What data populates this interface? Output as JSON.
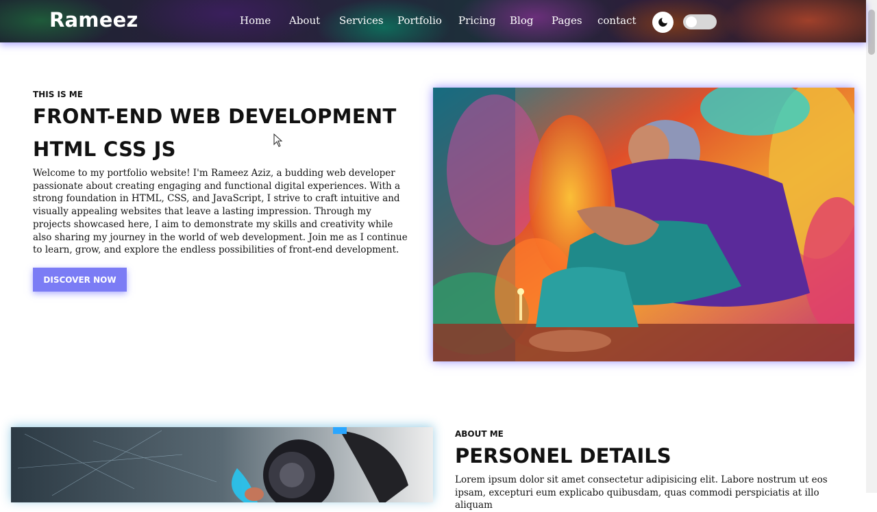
{
  "header": {
    "brand": "Rameez",
    "nav": [
      {
        "label": "Home"
      },
      {
        "label": "About"
      },
      {
        "label": "Services"
      },
      {
        "label": "Portfolio"
      },
      {
        "label": "Pricing"
      },
      {
        "label": "Blog"
      },
      {
        "label": "Pages"
      },
      {
        "label": "contact"
      }
    ],
    "theme_icon": "moon-icon",
    "toggle_state": "off"
  },
  "hero": {
    "eyebrow": "THIS IS ME",
    "title_line1": "FRONT-END WEB DEVELOPMENT",
    "title_line2": "HTML CSS JS",
    "description": "Welcome to my portfolio website! I'm Rameez Aziz, a budding web developer passionate about creating engaging and functional digital experiences. With a strong foundation in HTML, CSS, and JavaScript, I strive to craft intuitive and visually appealing websites that leave a lasting impression. Through my projects showcased here, I aim to demonstrate my skills and creativity while also sharing my journey in the world of web development. Join me as I continue to learn, grow, and explore the endless possibilities of front-end development.",
    "cta_label": "DISCOVER NOW"
  },
  "about": {
    "eyebrow": "ABOUT ME",
    "title": "PERSONEL DETAILS",
    "text": "Lorem ipsum dolor sit amet consectetur adipisicing elit. Labore nostrum ut eos ipsam, excepturi eum explicabo quibusdam, quas commodi perspiciatis at illo aliquam"
  },
  "colors": {
    "accent": "#7b7cf5",
    "nav_glow": "#7b6eff"
  }
}
